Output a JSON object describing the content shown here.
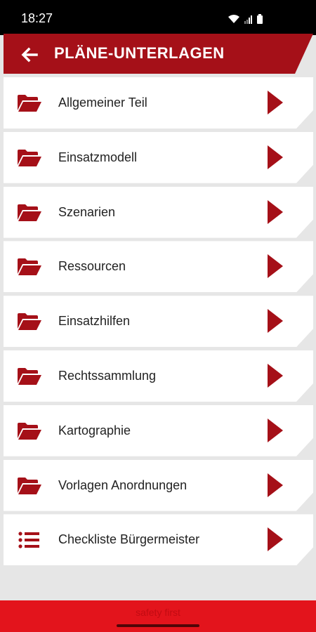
{
  "status_bar": {
    "time": "18:27",
    "icons": [
      "wifi-icon",
      "signal-icon",
      "battery-icon"
    ]
  },
  "header": {
    "title": "PLÄNE-UNTERLAGEN",
    "back_icon": "arrow-left-icon"
  },
  "list": {
    "items": [
      {
        "label": "Allgemeiner Teil",
        "icon": "folder-open-icon"
      },
      {
        "label": "Einsatzmodell",
        "icon": "folder-open-icon"
      },
      {
        "label": "Szenarien",
        "icon": "folder-open-icon"
      },
      {
        "label": "Ressourcen",
        "icon": "folder-open-icon"
      },
      {
        "label": "Einsatzhilfen",
        "icon": "folder-open-icon"
      },
      {
        "label": "Rechtssammlung",
        "icon": "folder-open-icon"
      },
      {
        "label": "Kartographie",
        "icon": "folder-open-icon"
      },
      {
        "label": "Vorlagen Anordnungen",
        "icon": "folder-open-icon"
      },
      {
        "label": "Checkliste Bürgermeister",
        "icon": "list-icon"
      }
    ]
  },
  "footer": {
    "text": "safety first"
  },
  "colors": {
    "brand_red": "#a51018",
    "footer_red": "#e3141c",
    "background": "#e6e6e6"
  }
}
